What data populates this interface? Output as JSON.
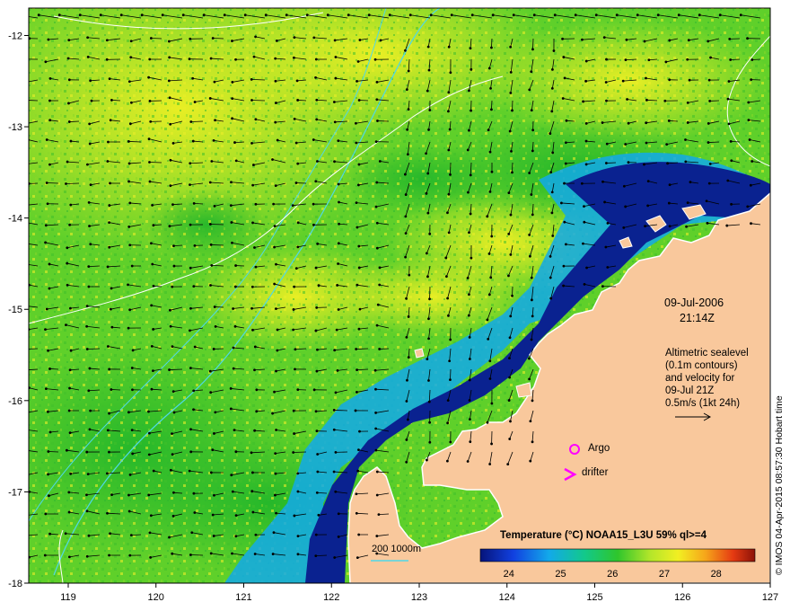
{
  "map": {
    "x_ticks": [
      "119",
      "120",
      "121",
      "122",
      "123",
      "124",
      "125",
      "126",
      "127"
    ],
    "y_ticks": [
      "-12",
      "-13",
      "-14",
      "-15",
      "-16",
      "-17",
      "-18"
    ],
    "lon_range": [
      118.55,
      127.0
    ],
    "lat_range": [
      -18.0,
      -11.7
    ]
  },
  "labels": {
    "date": "09-Jul-2006",
    "time": "21:14Z",
    "alt_line1": "Altimetric sealevel",
    "alt_line2": "(0.1m contours)",
    "alt_line3": "and velocity for",
    "alt_line4": "09-Jul 21Z",
    "scale_text": "0.5m/s (1kt 24h)",
    "argo": "Argo",
    "drifter": "drifter",
    "depth_contours": "200  1000m",
    "credit": "© IMOS 04-Apr-2015 08:57:30 Hobart time"
  },
  "colorbar": {
    "title": "Temperature (°C) NOAA15_L3U 59% ql>=4",
    "ticks": [
      "24",
      "25",
      "26",
      "27",
      "28"
    ]
  },
  "colors": {
    "land": "#f9c89c",
    "warm_sst": "#e8ef2a",
    "mid_sst": "#2fc62c",
    "cool_sst": "#12a9ea",
    "cold_sst": "#0a2290",
    "argo": "#ff00ff",
    "contour_200": "#4fd8e8"
  }
}
